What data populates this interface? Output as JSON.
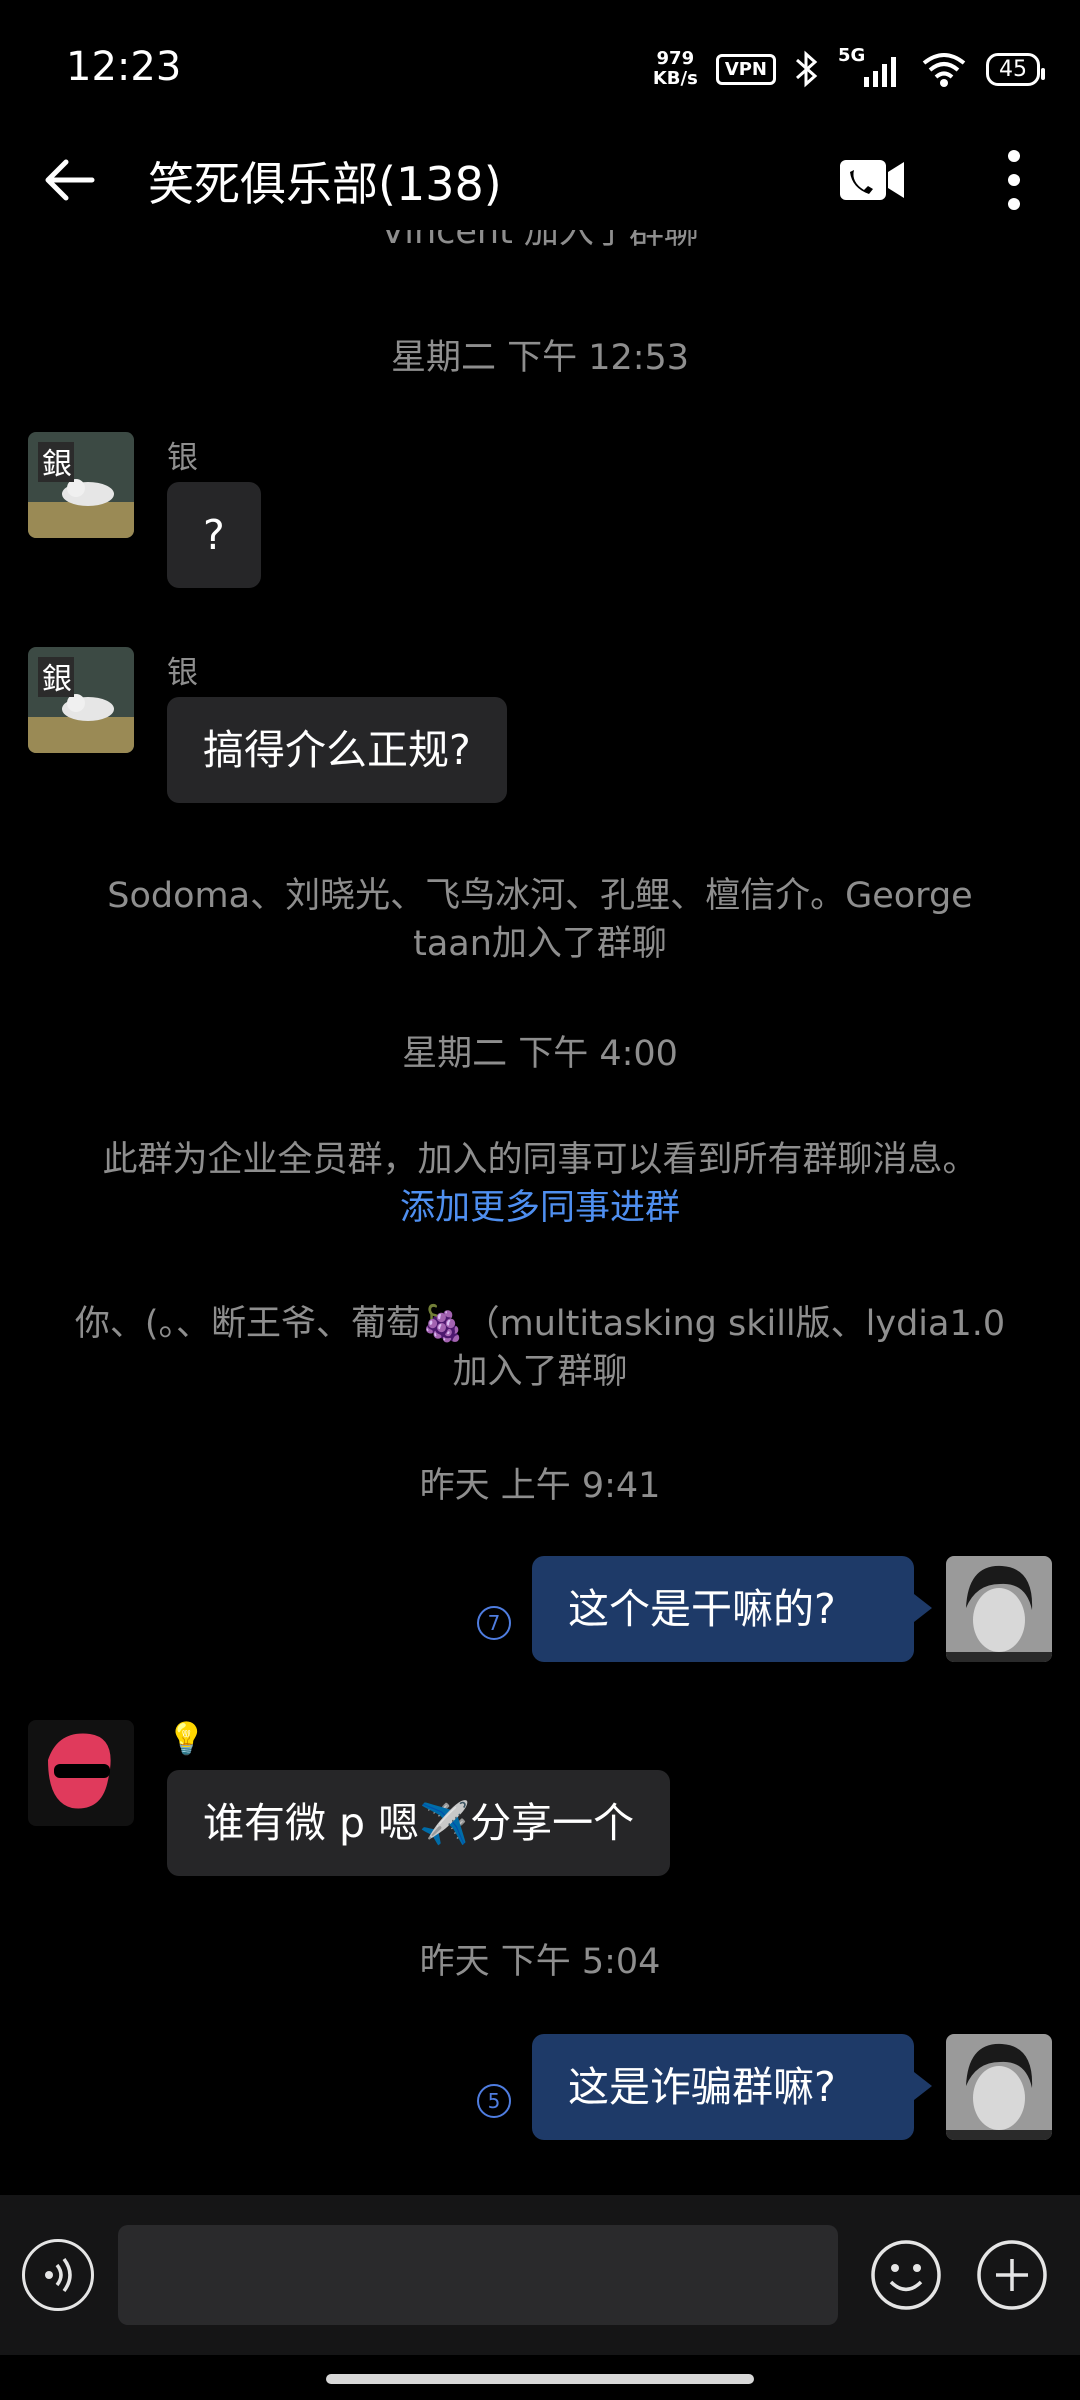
{
  "status_bar": {
    "time": "12:23",
    "net_speed_value": "979",
    "net_speed_unit": "KB/s",
    "vpn_label": "VPN",
    "network": "5G",
    "battery": "45",
    "icons": [
      "bluetooth-icon",
      "signal-icon",
      "wifi-icon",
      "battery-icon"
    ]
  },
  "header": {
    "title": "笑死俱乐部(138)",
    "icons": [
      "back-arrow-icon",
      "video-call-icon",
      "more-vertical-icon"
    ]
  },
  "chat": {
    "top_partial": "Vincent 加入了群聊",
    "ts1": "星期二  下午 12:53",
    "msg1": {
      "sender": "银",
      "text": "?"
    },
    "msg2": {
      "sender": "银",
      "text": "搞得介么正规?"
    },
    "join1_line1": "Sodoma、刘晓光、飞鸟冰河、孔鲤、檀信介。George",
    "join1_line2": "taan加入了群聊",
    "ts2": "星期二  下午 4:00",
    "notice_text": "此群为企业全员群，加入的同事可以看到所有群聊消息。",
    "notice_link": "添加更多同事进群",
    "join2_line1": "你、(。、断王爷、葡萄🍇（multitasking skill版、lydia1.0",
    "join2_line2": "加入了群聊",
    "ts3": "昨天  上午 9:41",
    "my_msg1": {
      "text": "这个是干嘛的?",
      "unread": "7"
    },
    "msg3": {
      "sender": "💡",
      "text": "谁有微 p 嗯✈️分享一个"
    },
    "ts4": "昨天  下午 5:04",
    "my_msg2": {
      "text": "这是诈骗群嘛?",
      "unread": "5"
    }
  },
  "input_bar": {
    "icons": [
      "voice-icon",
      "emoji-icon",
      "plus-icon"
    ]
  },
  "colors": {
    "background": "#000000",
    "my_bubble": "#1e3a68",
    "other_bubble": "#262628",
    "link": "#4f8ff0",
    "system_text": "#8e8e8e"
  }
}
